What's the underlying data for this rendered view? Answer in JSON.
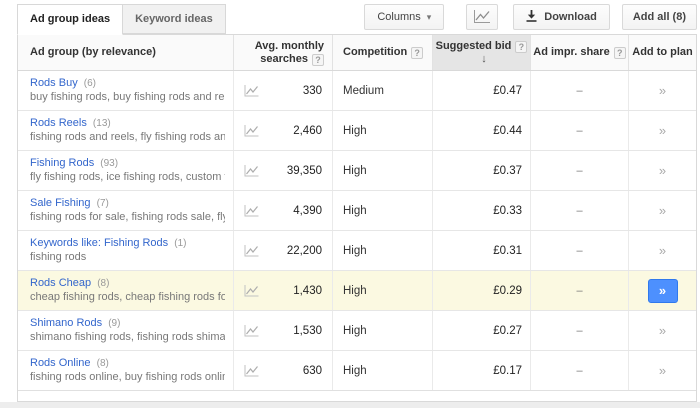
{
  "tabs": [
    {
      "label": "Ad group ideas",
      "active": true
    },
    {
      "label": "Keyword ideas",
      "active": false
    }
  ],
  "toolbar": {
    "columns_label": "Columns",
    "download_label": "Download",
    "add_all_label": "Add all (8)"
  },
  "icons": {
    "caret_down": "▾",
    "help": "?",
    "sort_desc": "↓",
    "double_chevron": "»"
  },
  "table": {
    "headers": [
      {
        "label": "Ad group (by relevance)"
      },
      {
        "label": "Avg. monthly searches",
        "help": true
      },
      {
        "label": "Competition",
        "help": true
      },
      {
        "label": "Suggested bid",
        "help": true,
        "sorted": "desc"
      },
      {
        "label": "Ad impr. share",
        "help": true
      },
      {
        "label": "Add to plan"
      }
    ],
    "rows": [
      {
        "name": "Rods Buy",
        "count": "(6)",
        "desc": "buy fishing rods, buy fishing rods and reels, b…",
        "searches": "330",
        "competition": "Medium",
        "bid": "£0.47",
        "impr_share": "–",
        "highlighted": false,
        "added": false
      },
      {
        "name": "Rods Reels",
        "count": "(13)",
        "desc": "fishing rods and reels, fly fishing rods and ree..",
        "searches": "2,460",
        "competition": "High",
        "bid": "£0.44",
        "impr_share": "–",
        "highlighted": false,
        "added": false
      },
      {
        "name": "Fishing Rods",
        "count": "(93)",
        "desc": "fly fishing rods, ice fishing rods, custom fishin…",
        "searches": "39,350",
        "competition": "High",
        "bid": "£0.37",
        "impr_share": "–",
        "highlighted": false,
        "added": false
      },
      {
        "name": "Sale Fishing",
        "count": "(7)",
        "desc": "fishing rods for sale, fishing rods sale, fly fish…",
        "searches": "4,390",
        "competition": "High",
        "bid": "£0.33",
        "impr_share": "–",
        "highlighted": false,
        "added": false
      },
      {
        "name": "Keywords like: Fishing Rods",
        "count": "(1)",
        "desc": "fishing rods",
        "searches": "22,200",
        "competition": "High",
        "bid": "£0.31",
        "impr_share": "–",
        "highlighted": false,
        "added": false
      },
      {
        "name": "Rods Cheap",
        "count": "(8)",
        "desc": "cheap fishing rods, cheap fishing rods for sal…",
        "searches": "1,430",
        "competition": "High",
        "bid": "£0.29",
        "impr_share": "–",
        "highlighted": true,
        "added": true
      },
      {
        "name": "Shimano Rods",
        "count": "(9)",
        "desc": "shimano fishing rods, fishing rods shimano, s…",
        "searches": "1,530",
        "competition": "High",
        "bid": "£0.27",
        "impr_share": "–",
        "highlighted": false,
        "added": false
      },
      {
        "name": "Rods Online",
        "count": "(8)",
        "desc": "fishing rods online, buy fishing rods online, o…",
        "searches": "630",
        "competition": "High",
        "bid": "£0.17",
        "impr_share": "–",
        "highlighted": false,
        "added": false
      }
    ]
  },
  "colors": {
    "accent_blue": "#4d90fe",
    "link_blue": "#3366cc",
    "row_highlight": "#fbf9e1",
    "sorted_header_bg": "#e5e5e5"
  }
}
